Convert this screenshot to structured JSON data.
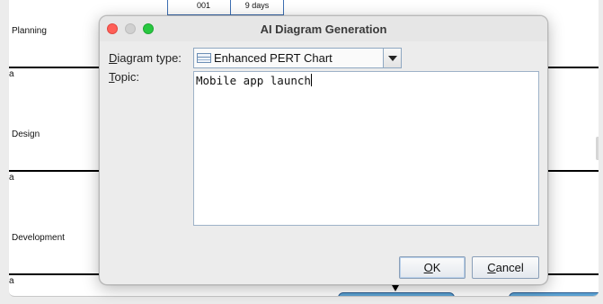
{
  "background": {
    "lanes": [
      {
        "label": "Planning"
      },
      {
        "label": "Design"
      },
      {
        "label": "Development"
      }
    ],
    "lane_marker": "a",
    "top_cells": [
      "001",
      "9 days"
    ]
  },
  "dialog": {
    "title": "AI Diagram Generation",
    "diagram_type": {
      "label_mnemonic": "D",
      "label_rest": "iagram type:",
      "value": "Enhanced PERT Chart",
      "icon": "chart-table-icon"
    },
    "topic": {
      "label_mnemonic": "T",
      "label_rest": "opic:",
      "value": "Mobile app launch"
    },
    "buttons": {
      "ok_mnemonic": "O",
      "ok_rest": "K",
      "cancel_mnemonic": "C",
      "cancel_rest": "ancel"
    }
  },
  "colors": {
    "close": "#ff5f57",
    "minimize": "#d0d0d0",
    "maximize": "#28c840",
    "lane_line": "#000000",
    "cell_border": "#3d6fb3"
  }
}
